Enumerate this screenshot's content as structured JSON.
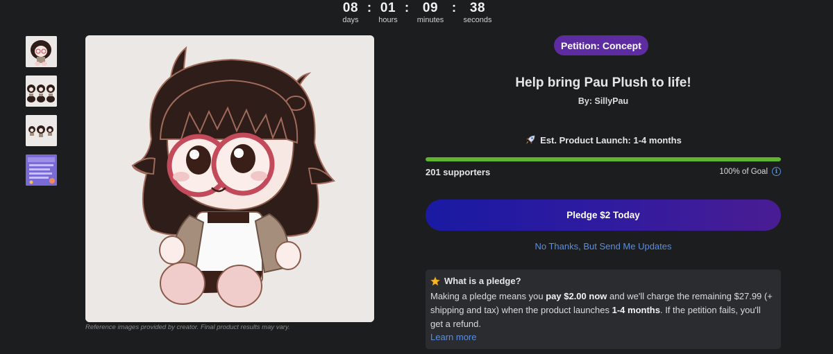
{
  "countdown": {
    "days": "08",
    "days_label": "days",
    "hours": "01",
    "hours_label": "hours",
    "minutes": "09",
    "minutes_label": "minutes",
    "seconds": "38",
    "seconds_label": "seconds",
    "separator": ":"
  },
  "gallery": {
    "caption": "Reference images provided by creator. Final product results may vary."
  },
  "campaign": {
    "badge": "Petition: Concept",
    "title": "Help bring Pau Plush to life!",
    "byline": "By: SillyPau",
    "launch_icon": "rocket-icon",
    "launch_text": "Est. Product Launch: 1-4 months",
    "progress_fraction": 1.0,
    "supporters": "201 supporters",
    "goal_text": "100% of Goal",
    "pledge_button": "Pledge $2 Today",
    "no_thanks_link": "No Thanks, But Send Me Updates"
  },
  "pledge_info": {
    "icon": "star-icon",
    "heading": "What is a pledge?",
    "text_1": "Making a pledge means you ",
    "bold_1": "pay $2.00 now",
    "text_2": " and we'll charge the remaining $27.99 (+ shipping and tax) when the product launches ",
    "bold_2": "1-4 months",
    "text_3": ". If the petition fails, you'll get a refund.",
    "learn_more": "Learn more"
  },
  "colors": {
    "background": "#1c1d1f",
    "badge": "#5d2ca0",
    "progress": "#5fb52c",
    "link": "#5b8ee0"
  }
}
